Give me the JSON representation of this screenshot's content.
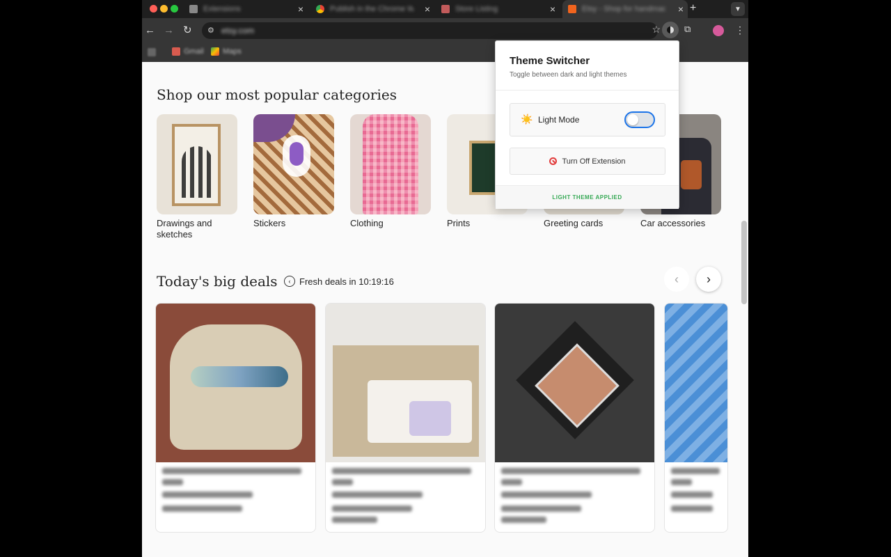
{
  "browser": {
    "tabs": [
      {
        "title": "Extensions"
      },
      {
        "title": "Publish in the Chrome Web Store"
      },
      {
        "title": "Store Listing"
      },
      {
        "title": "Etsy - Shop for handmade"
      }
    ],
    "url": "etsy.com",
    "bookmarks": [
      {
        "label": "Gmail"
      },
      {
        "label": "Maps"
      }
    ]
  },
  "categories_section": {
    "title": "Shop our most popular categories",
    "items": [
      {
        "label": "Drawings and sketches"
      },
      {
        "label": "Stickers"
      },
      {
        "label": "Clothing"
      },
      {
        "label": "Prints"
      },
      {
        "label": "Greeting cards"
      },
      {
        "label": "Car accessories"
      }
    ]
  },
  "deals_section": {
    "title": "Today's big deals",
    "timer_text": "Fresh deals in 10:19:16",
    "prev_icon": "chevron-left-icon",
    "next_icon": "chevron-right-icon"
  },
  "popup": {
    "title": "Theme Switcher",
    "subtitle": "Toggle between dark and light themes",
    "mode_label": "Light Mode",
    "toggle_on": false,
    "turn_off_label": "Turn Off Extension",
    "status_text": "LIGHT THEME APPLIED",
    "accent_color": "#1a73e8",
    "status_color": "#34a853"
  }
}
